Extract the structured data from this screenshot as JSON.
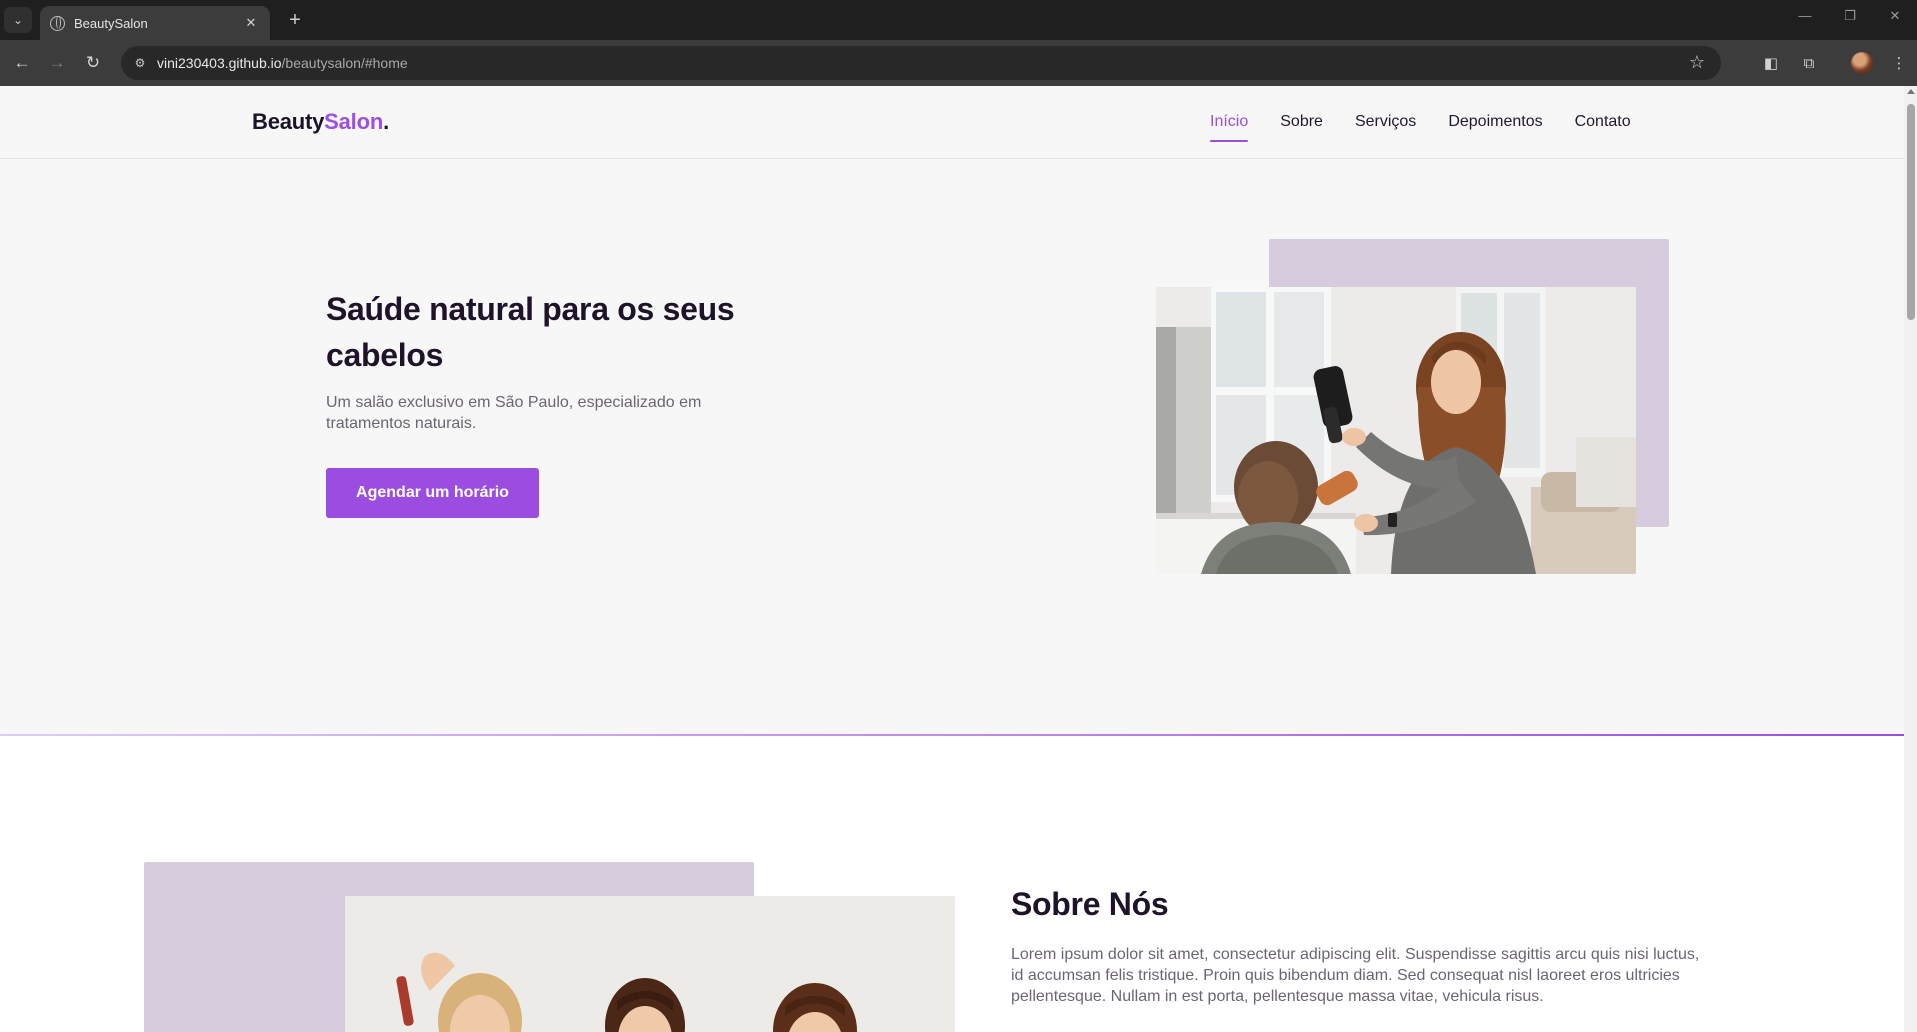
{
  "browser": {
    "tab_title": "BeautySalon",
    "url_host": "vini230403.github.io",
    "url_path": "/beautysalon/#home"
  },
  "site": {
    "logo": {
      "part1": "Beauty",
      "part2": "Salon",
      "part3": "."
    },
    "nav": [
      {
        "label": "Início",
        "active": true
      },
      {
        "label": "Sobre"
      },
      {
        "label": "Serviços"
      },
      {
        "label": "Depoimentos"
      },
      {
        "label": "Contato"
      }
    ]
  },
  "hero": {
    "title": "Saúde natural para os seus cabelos",
    "text": "Um salão exclusivo em São Paulo, especializado em tratamentos naturais.",
    "cta": "Agendar um horário"
  },
  "about": {
    "title": "Sobre Nós",
    "text": "Lorem ipsum dolor sit amet, consectetur adipiscing elit. Suspendisse sagittis arcu quis nisi luctus, id accumsan felis tristique. Proin quis bibendum diam. Sed consequat nisl laoreet eros ultricies pellentesque. Nullam in est porta, pellentesque massa vitae, vehicula risus."
  },
  "colors": {
    "accent": "#9b4de0",
    "heading": "#1e1329",
    "body_text": "#6b6570",
    "image_block": "#d6ccde",
    "page_bg": "#f8f7f8"
  }
}
